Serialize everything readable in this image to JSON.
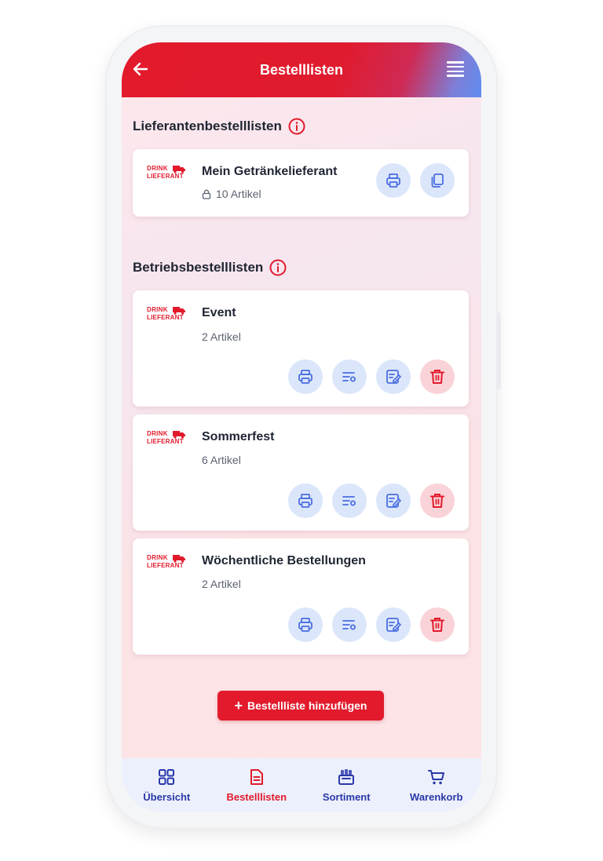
{
  "header": {
    "title": "Bestelllisten"
  },
  "sections": {
    "supplier": {
      "title": "Lieferantenbestelllisten"
    },
    "business": {
      "title": "Betriebsbestelllisten"
    }
  },
  "brand": {
    "line1": "DRINK",
    "line2": "LIEFERANT"
  },
  "supplier_list": {
    "name": "Mein Getränkelieferant",
    "count": "10 Artikel"
  },
  "business_lists": [
    {
      "name": "Event",
      "count": "2 Artikel"
    },
    {
      "name": "Sommerfest",
      "count": "6 Artikel"
    },
    {
      "name": "Wöchentliche Bestellungen",
      "count": "2 Artikel"
    }
  ],
  "add_button": {
    "label": "Bestellliste hinzufügen"
  },
  "nav": [
    {
      "label": "Übersicht",
      "icon": "grid-icon"
    },
    {
      "label": "Bestelllisten",
      "icon": "document-icon",
      "active": true
    },
    {
      "label": "Sortiment",
      "icon": "crate-icon"
    },
    {
      "label": "Warenkorb",
      "icon": "cart-icon"
    }
  ],
  "colors": {
    "brand_red": "#e21a2c",
    "nav_blue": "#2a38a8",
    "action_bg": "#dbe6fb",
    "danger_bg": "#f9d3d8"
  }
}
